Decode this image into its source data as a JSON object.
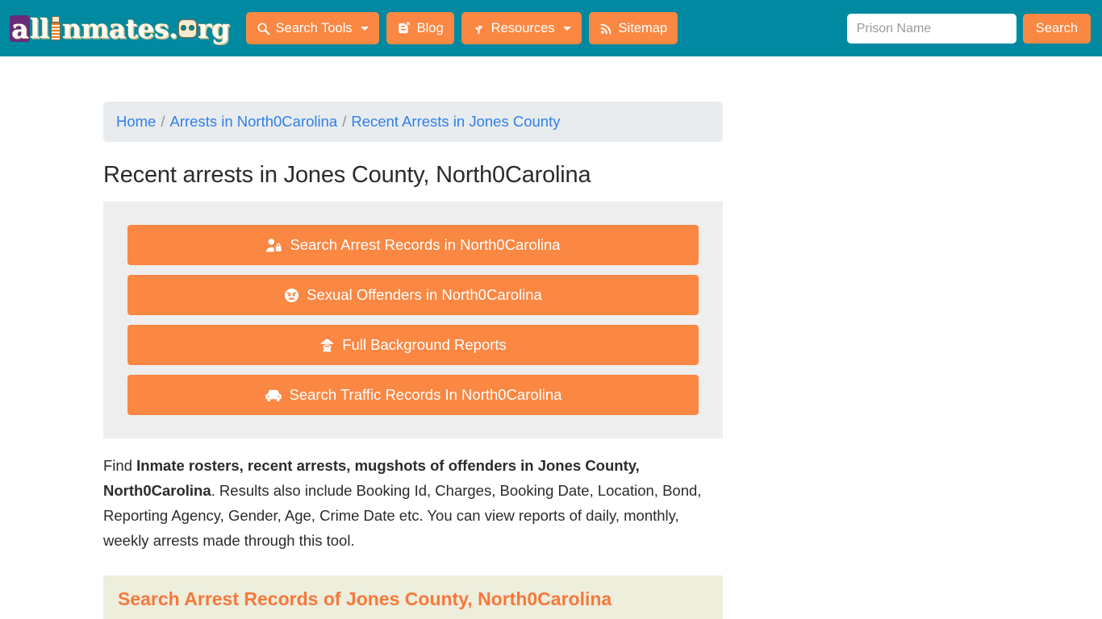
{
  "header": {
    "brand": {
      "name": "allInmates.org",
      "part_a": "a",
      "part_ll": "ll",
      "part_nmates": "nmates.",
      "part_rg": "rg"
    },
    "nav": [
      {
        "label": "Search Tools",
        "icon": "search-icon",
        "has_dropdown": true
      },
      {
        "label": "Blog",
        "icon": "blogger-icon",
        "has_dropdown": false
      },
      {
        "label": "Resources",
        "icon": "seedling-icon",
        "has_dropdown": true
      },
      {
        "label": "Sitemap",
        "icon": "rss-icon",
        "has_dropdown": false
      }
    ],
    "search": {
      "placeholder": "Prison Name",
      "value": "",
      "button_label": "Search"
    }
  },
  "breadcrumb": {
    "items": [
      {
        "label": "Home"
      },
      {
        "label": "Arrests in North0Carolina"
      },
      {
        "label": "Recent Arrests in Jones County"
      }
    ],
    "separator": "/"
  },
  "main": {
    "title": "Recent arrests in Jones County, North0Carolina",
    "action_buttons": [
      {
        "label": "Search Arrest Records in North0Carolina",
        "icon": "user-lock-icon"
      },
      {
        "label": "Sexual Offenders in North0Carolina",
        "icon": "angry-face-icon"
      },
      {
        "label": "Full Background Reports",
        "icon": "user-secret-icon"
      },
      {
        "label": "Search Traffic Records In North0Carolina",
        "icon": "car-icon"
      }
    ],
    "lede": {
      "prefix": "Find ",
      "bold": "Inmate rosters, recent arrests, mugshots of offenders in Jones County, North0Carolina",
      "suffix": ". Results also include Booking Id, Charges, Booking Date, Location, Bond, Reporting Agency, Gender, Age, Crime Date etc. You can view reports of daily, monthly, weekly arrests made through this tool."
    },
    "section_heading": "Search Arrest Records of Jones County, North0Carolina"
  },
  "colors": {
    "header_teal": "#0089a0",
    "accent_orange": "#fa8742",
    "panel_gray": "#eeeeee",
    "breadcrumb_gray": "#e9ecef",
    "band_cream": "#eeeedc",
    "link_blue": "#2f7fe8"
  }
}
